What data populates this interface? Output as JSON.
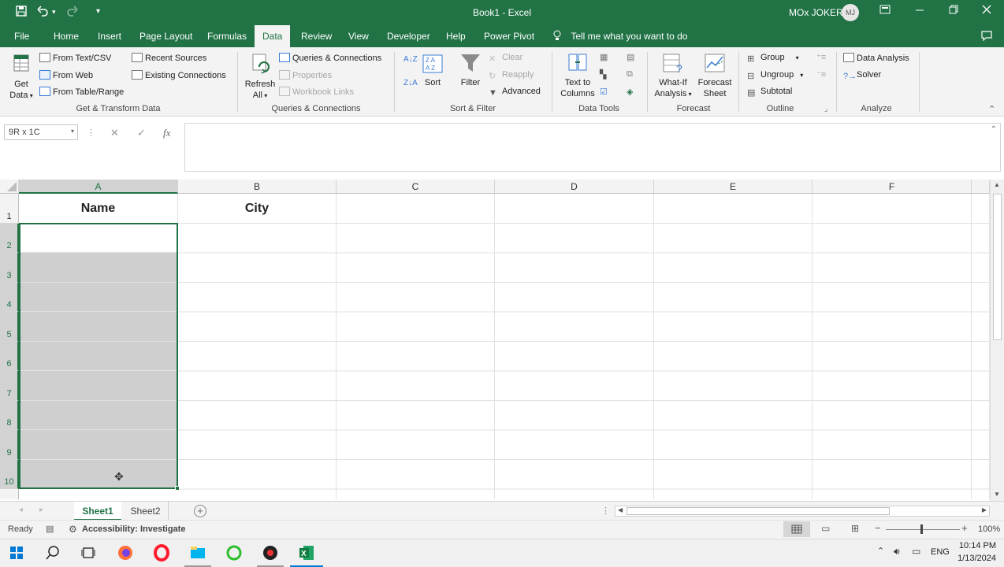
{
  "titlebar": {
    "title": "Book1  -  Excel",
    "user_name": "MOx JOKER",
    "user_initials": "MJ",
    "icons": [
      "save-icon",
      "undo-icon",
      "redo-icon",
      "customize-qat-icon",
      "ribbon-display-icon",
      "minimize-icon",
      "restore-icon",
      "close-icon"
    ]
  },
  "tabs": {
    "items": [
      "File",
      "Home",
      "Insert",
      "Page Layout",
      "Formulas",
      "Data",
      "Review",
      "View",
      "Developer",
      "Help",
      "Power Pivot"
    ],
    "active": "Data",
    "tell_me": "Tell me what you want to do"
  },
  "ribbon": {
    "get_transform": {
      "get_data_1": "Get",
      "get_data_2": "Data",
      "from_text_csv": "From Text/CSV",
      "from_web": "From Web",
      "from_table_range": "From Table/Range",
      "recent_sources": "Recent Sources",
      "existing_connections": "Existing Connections",
      "label": "Get & Transform Data"
    },
    "queries": {
      "refresh_1": "Refresh",
      "refresh_2": "All",
      "queries_connections": "Queries & Connections",
      "properties": "Properties",
      "workbook_links": "Workbook Links",
      "label": "Queries & Connections"
    },
    "sort_filter": {
      "sort": "Sort",
      "filter": "Filter",
      "clear": "Clear",
      "reapply": "Reapply",
      "advanced": "Advanced",
      "label": "Sort & Filter"
    },
    "data_tools": {
      "text_to_1": "Text to",
      "text_to_2": "Columns",
      "label": "Data Tools"
    },
    "forecast": {
      "whatif_1": "What-If",
      "whatif_2": "Analysis",
      "forecast_1": "Forecast",
      "forecast_2": "Sheet",
      "label": "Forecast"
    },
    "outline": {
      "group": "Group",
      "ungroup": "Ungroup",
      "subtotal": "Subtotal",
      "label": "Outline"
    },
    "analyze": {
      "data_analysis": "Data Analysis",
      "solver": "Solver",
      "label": "Analyze"
    }
  },
  "formula_bar": {
    "name_box": "9R x 1C",
    "fx": "fx",
    "formula": ""
  },
  "grid": {
    "columns": [
      "A",
      "B",
      "C",
      "D",
      "E",
      "F"
    ],
    "rows": [
      "1",
      "2",
      "3",
      "4",
      "5",
      "6",
      "7",
      "8",
      "9",
      "10"
    ],
    "cells": {
      "A1": "Name",
      "B1": "City"
    }
  },
  "sheets": {
    "tabs": [
      "Sheet1",
      "Sheet2"
    ],
    "active": "Sheet1"
  },
  "status": {
    "ready": "Ready",
    "accessibility": "Accessibility: Investigate",
    "zoom": "100%"
  },
  "taskbar": {
    "language": "ENG",
    "time": "10:14 PM",
    "date": "1/13/2024"
  },
  "colors": {
    "brand": "#217346",
    "selection_fill": "#cfcfcf"
  }
}
